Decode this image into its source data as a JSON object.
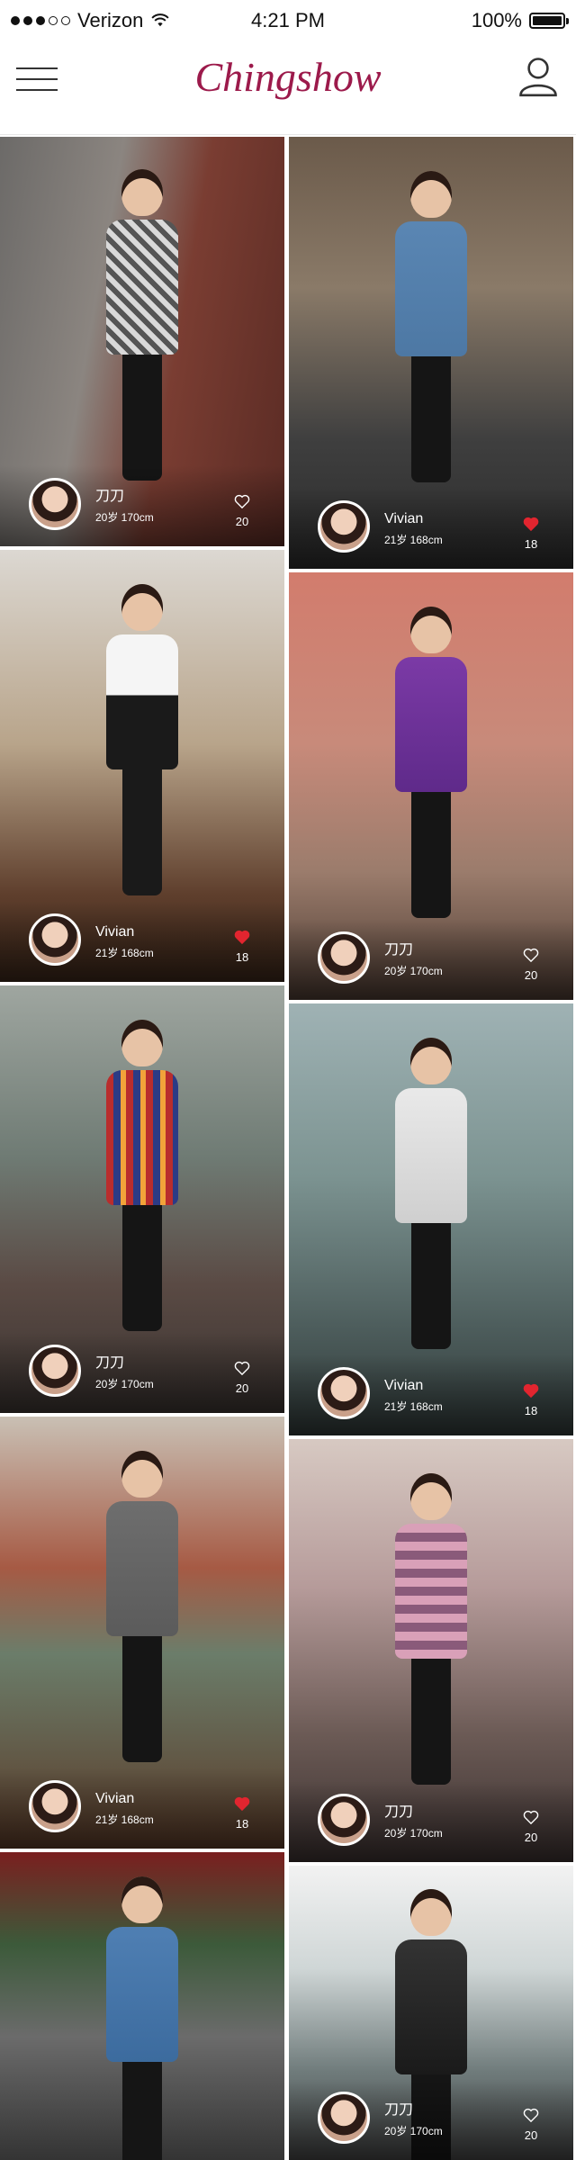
{
  "status_bar": {
    "carrier": "Verizon",
    "time": "4:21 PM",
    "battery": "100%",
    "battery_level": 1.0,
    "signal_bars_filled": 3,
    "signal_bars_total": 5
  },
  "nav": {
    "title": "Chingshow",
    "menu_icon": "hamburger-menu-icon",
    "profile_icon": "user-profile-icon"
  },
  "colors": {
    "brand": "#9c1a4b",
    "liked": "#e2252f",
    "text_on_photo": "#ffffff"
  },
  "feed": {
    "left_column": [
      {
        "name": "刀刀",
        "meta": "20岁 170cm",
        "likes": "20",
        "liked": false
      },
      {
        "name": "Vivian",
        "meta": "21岁 168cm",
        "likes": "18",
        "liked": true
      },
      {
        "name": "刀刀",
        "meta": "20岁 170cm",
        "likes": "20",
        "liked": false
      },
      {
        "name": "Vivian",
        "meta": "21岁 168cm",
        "likes": "18",
        "liked": true
      },
      {
        "name": "",
        "meta": "",
        "likes": "",
        "liked": false
      }
    ],
    "right_column": [
      {
        "name": "Vivian",
        "meta": "21岁 168cm",
        "likes": "18",
        "liked": true
      },
      {
        "name": "刀刀",
        "meta": "20岁 170cm",
        "likes": "20",
        "liked": false
      },
      {
        "name": "Vivian",
        "meta": "21岁 168cm",
        "likes": "18",
        "liked": true
      },
      {
        "name": "刀刀",
        "meta": "20岁 170cm",
        "likes": "20",
        "liked": false
      },
      {
        "name": "刀刀",
        "meta": "20岁 170cm",
        "likes": "20",
        "liked": false
      }
    ]
  }
}
